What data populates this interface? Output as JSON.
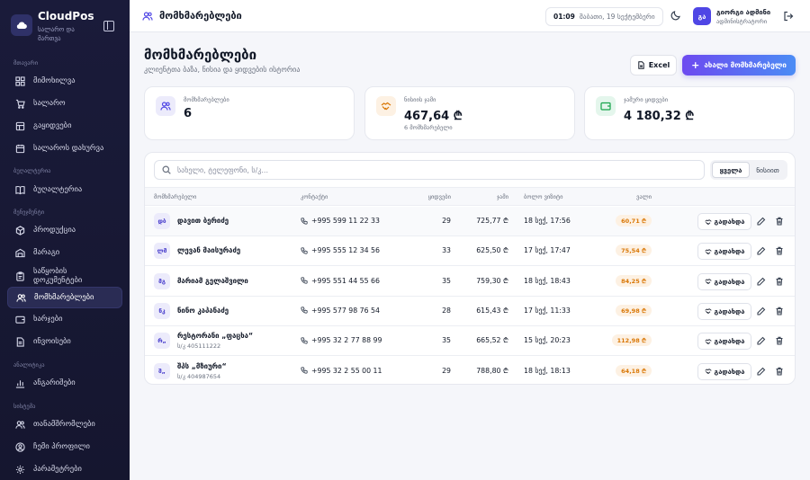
{
  "app": {
    "name": "CloudPos",
    "subtitle": "სალარო და მართვა"
  },
  "sidebar": {
    "sections": [
      {
        "label": "მთავარი"
      },
      {
        "label": "ბუღალტერია"
      },
      {
        "label": "მენეჯმენტი"
      },
      {
        "label": "ანალიტიკა"
      },
      {
        "label": "სისტემა"
      }
    ],
    "items": [
      {
        "label": "მიმოხილვა",
        "icon": "dashboard-icon"
      },
      {
        "label": "სალარო",
        "icon": "cart-icon"
      },
      {
        "label": "გაყიდვები",
        "icon": "receipt-icon"
      },
      {
        "label": "სალაროს დახურვა",
        "icon": "calendar-icon"
      },
      {
        "label": "ბუღალტერია",
        "icon": "book-icon"
      },
      {
        "label": "პროდუქცია",
        "icon": "box-icon"
      },
      {
        "label": "მარაგი",
        "icon": "warehouse-icon"
      },
      {
        "label": "საწყობის დოკუმენტები",
        "icon": "clipboard-icon"
      },
      {
        "label": "მომხმარებლები",
        "icon": "users-icon",
        "active": true
      },
      {
        "label": "ხარჯები",
        "icon": "wallet-icon"
      },
      {
        "label": "ინვოისები",
        "icon": "document-icon"
      },
      {
        "label": "ანგარიშები",
        "icon": "bar-chart-icon"
      },
      {
        "label": "თანამშრომლები",
        "icon": "team-icon"
      },
      {
        "label": "ჩემი პროფილი",
        "icon": "user-circle-icon"
      },
      {
        "label": "პარამეტრები",
        "icon": "gear-icon"
      }
    ]
  },
  "topbar": {
    "title": "მომხმარებლები",
    "time": "01:09",
    "date": "შაბათი, 19 სექტემბერი",
    "avatar_initials": "გა",
    "user_name": "გიორგი ადმინი",
    "user_role": "ადმინისტრატორი"
  },
  "page": {
    "title": "მომხმარებლები",
    "subtitle": "კლიენტთა ბაზა, ნისია და ყიდვების ისტორია",
    "excel_label": "Excel",
    "add_label": "ახალი მომხმარებელი"
  },
  "stats": [
    {
      "label": "მომხმარებლები",
      "value": "6",
      "note": ""
    },
    {
      "label": "ნისიის ჯამი",
      "value": "467,64 ₾",
      "note": "6 მომხმარებელი"
    },
    {
      "label": "ჯამური ყიდვები",
      "value": "4 180,32 ₾",
      "note": ""
    }
  ],
  "table": {
    "search_placeholder": "სახელი, ტელეფონი, ს/კ...",
    "filters": [
      "ყველა",
      "ნისიით"
    ],
    "active_filter": "ყველა",
    "columns": [
      "მომხმარებელი",
      "კონტაქტი",
      "ყიდვები",
      "ჯამი",
      "ბოლო ვიზიტი",
      "ვალი"
    ],
    "pay_label": "გადახდა",
    "rows": [
      {
        "initials": "დბ",
        "name": "დავით ბერიძე",
        "sub": "",
        "phone": "+995 599 11 22 33",
        "orders": "29",
        "amount": "725,77 ₾",
        "last_visit": "18 სექ, 17:56",
        "debt": "60,71 ₾"
      },
      {
        "initials": "ლმ",
        "name": "ლევან მაისურაძე",
        "sub": "",
        "phone": "+995 555 12 34 56",
        "orders": "33",
        "amount": "625,50 ₾",
        "last_visit": "17 სექ, 17:47",
        "debt": "75,54 ₾"
      },
      {
        "initials": "მგ",
        "name": "მარიამ გელაშვილი",
        "sub": "",
        "phone": "+995 551 44 55 66",
        "orders": "35",
        "amount": "759,30 ₾",
        "last_visit": "18 სექ, 18:43",
        "debt": "84,25 ₾"
      },
      {
        "initials": "ნკ",
        "name": "ნინო კაპანაძე",
        "sub": "",
        "phone": "+995 577 98 76 54",
        "orders": "28",
        "amount": "615,43 ₾",
        "last_visit": "17 სექ, 11:33",
        "debt": "69,98 ₾"
      },
      {
        "initials": "რ„",
        "name": "რესტორანი „ფაცხა“",
        "sub": "ს/კ 405111222",
        "phone": "+995 32 2 77 88 99",
        "orders": "35",
        "amount": "665,52 ₾",
        "last_visit": "15 სექ, 20:23",
        "debt": "112,98 ₾"
      },
      {
        "initials": "შ„",
        "name": "შპს „მზიური“",
        "sub": "ს/კ 404987654",
        "phone": "+995 32 2 55 00 11",
        "orders": "29",
        "amount": "788,80 ₾",
        "last_visit": "18 სექ, 18:13",
        "debt": "64,18 ₾"
      }
    ]
  },
  "colors": {
    "sidebar_bg": "#1a1b3a",
    "accent": "#4f46e5",
    "debt_badge": "#d97706"
  }
}
